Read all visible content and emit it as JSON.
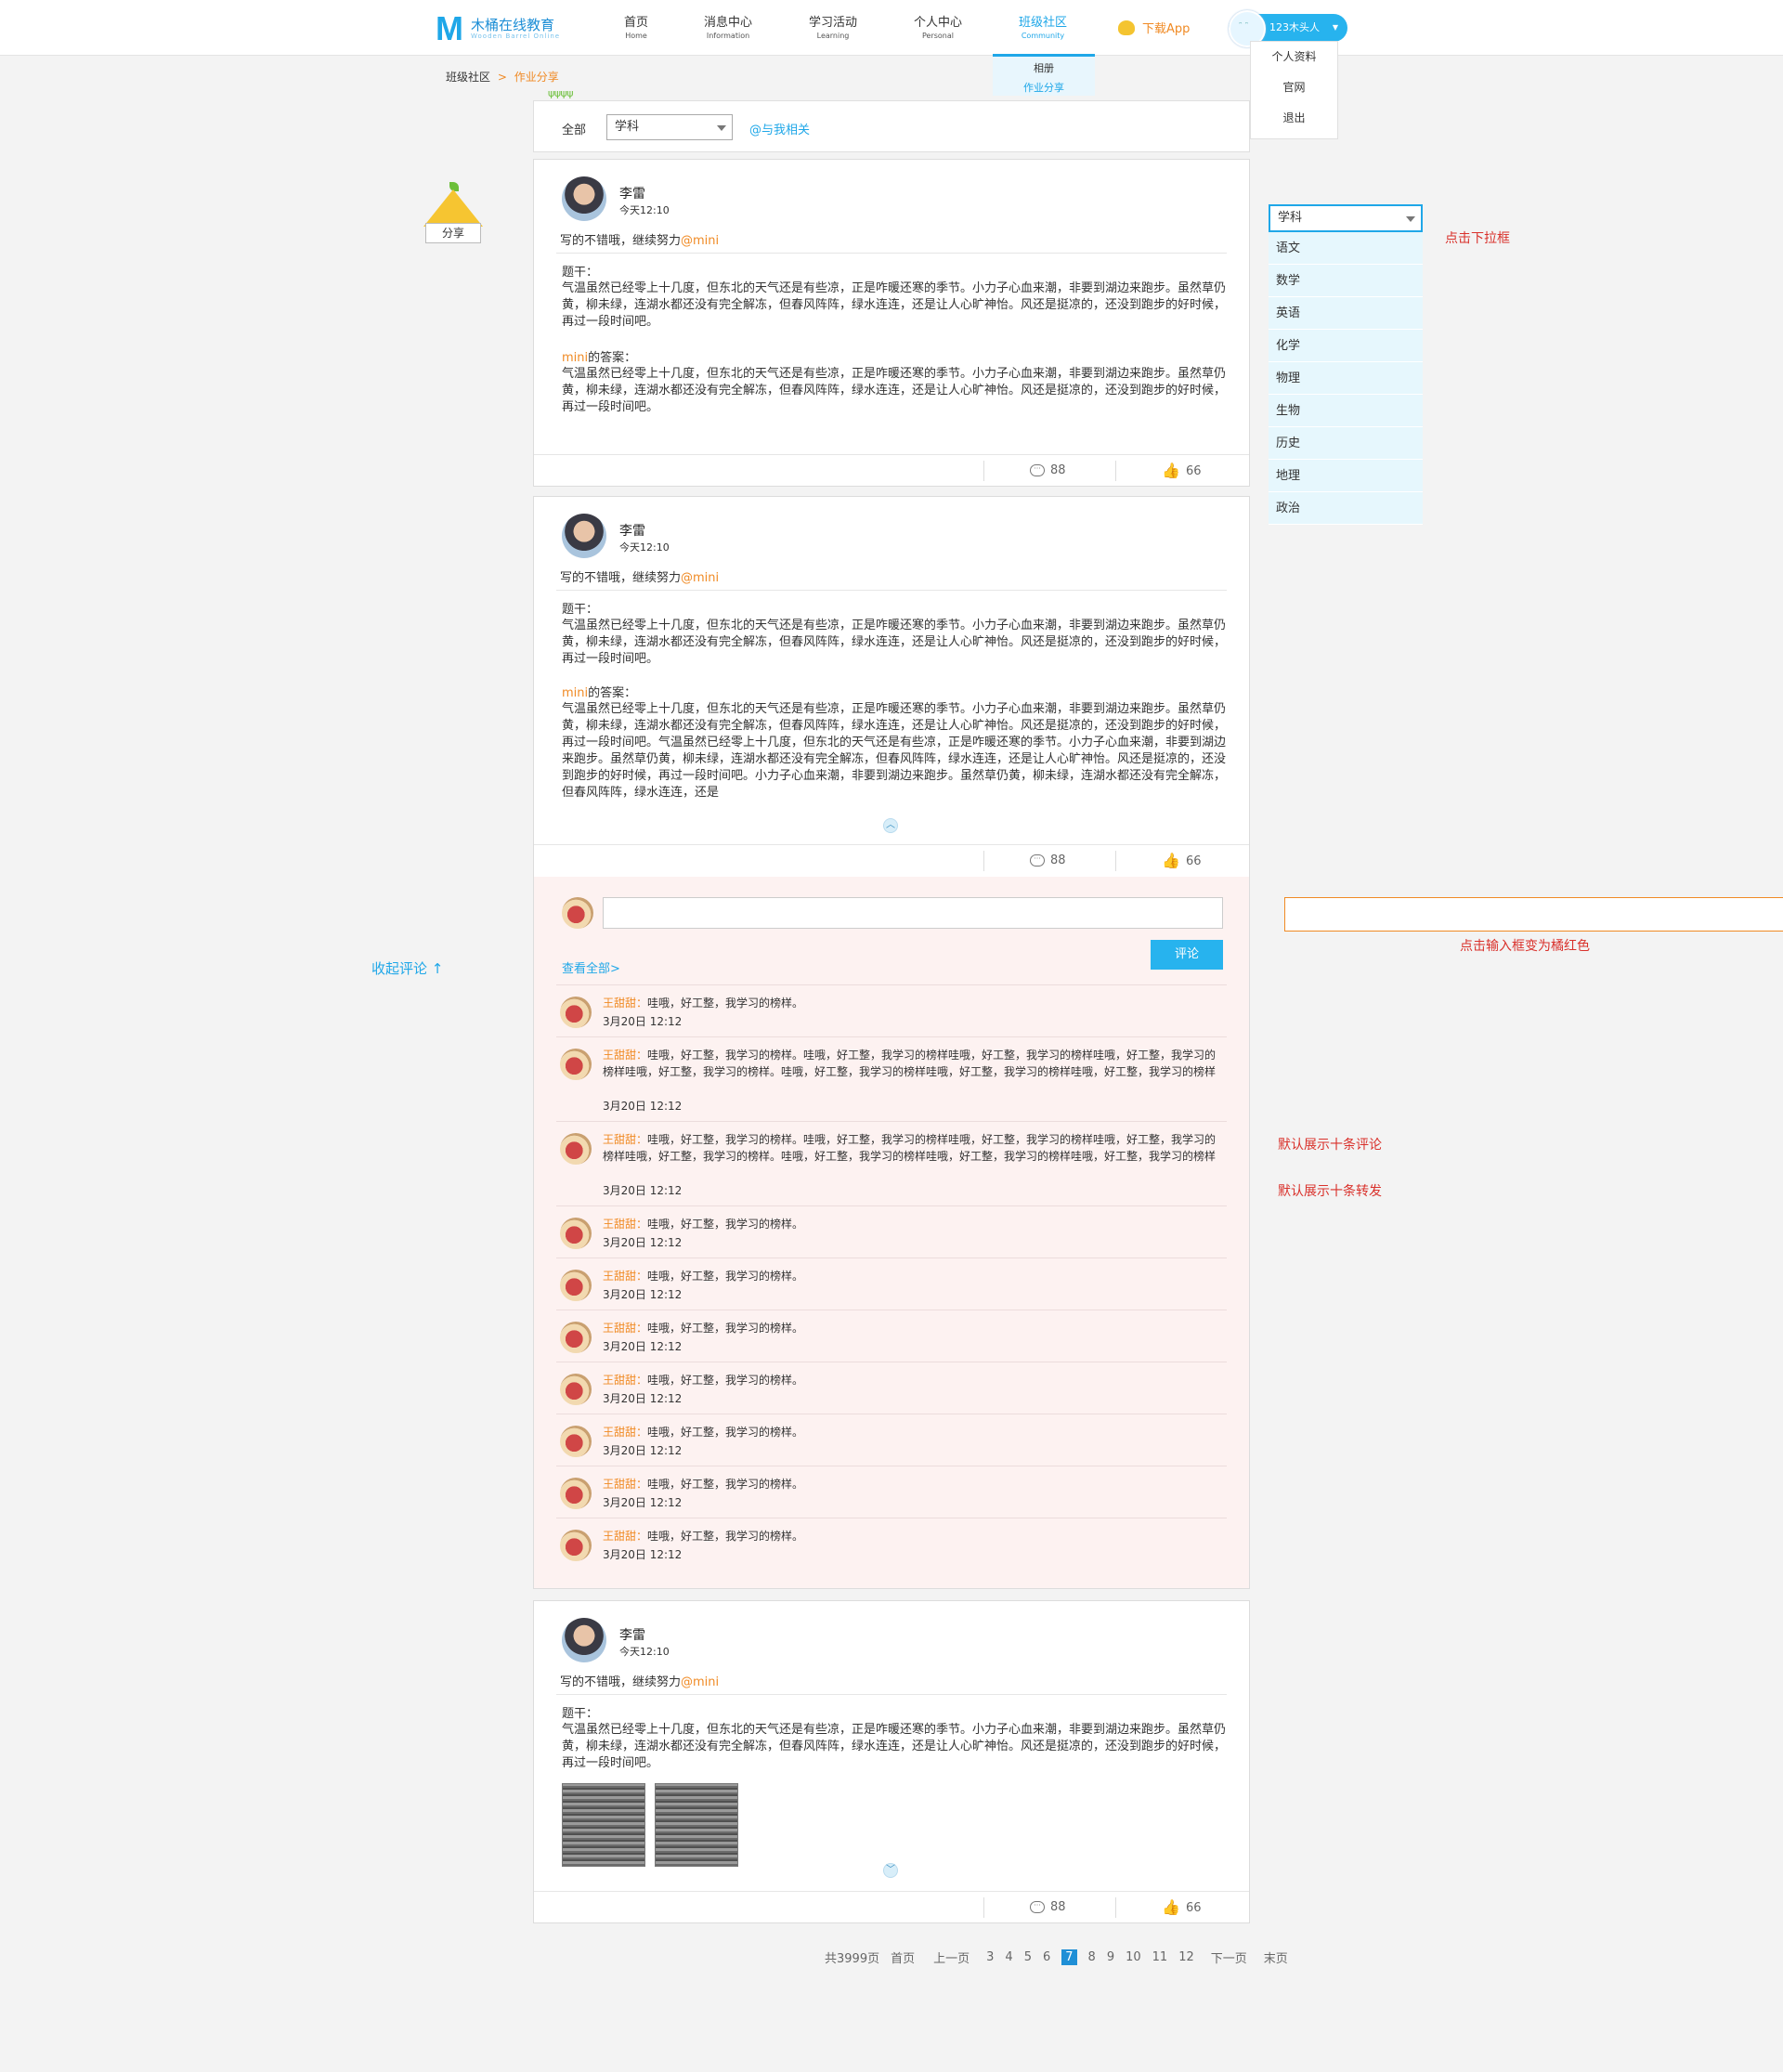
{
  "header": {
    "logo_mark": "M",
    "logo_text": "木桶在线教育",
    "logo_sub": "Wooden Barrel Online",
    "nav": [
      {
        "cn": "首页",
        "en": "Home"
      },
      {
        "cn": "消息中心",
        "en": "Information"
      },
      {
        "cn": "学习活动",
        "en": "Learning"
      },
      {
        "cn": "个人中心",
        "en": "Personal"
      },
      {
        "cn": "班级社区",
        "en": "Community"
      }
    ],
    "sub_menu": [
      "相册",
      "作业分享"
    ],
    "download": "下载App",
    "user_name": "123木头人",
    "user_menu": [
      "个人资料",
      "官网",
      "退出"
    ]
  },
  "breadcrumb": {
    "root": "班级社区",
    "sep": ">",
    "current": "作业分享"
  },
  "filter": {
    "all": "全部",
    "select": "学科",
    "related": "@与我相关"
  },
  "share_label": "分享",
  "posts": [
    {
      "author": "李雷",
      "time": "今天12:10",
      "comment": "写的不错哦，继续努力",
      "mention": "@mini",
      "q_label": "题干：",
      "question": "气温虽然已经零上十几度，但东北的天气还是有些凉，正是咋暖还寒的季节。小力子心血来潮，非要到湖边来跑步。虽然草仍黄，柳未绿，连湖水都还没有完全解冻，但春风阵阵，绿水连连，还是让人心旷神怡。风还是挺凉的，还没到跑步的好时候，再过一段时间吧。",
      "a_name": "mini",
      "a_label": "的答案：",
      "answer": "气温虽然已经零上十几度，但东北的天气还是有些凉，正是咋暖还寒的季节。小力子心血来潮，非要到湖边来跑步。虽然草仍黄，柳未绿，连湖水都还没有完全解冻，但春风阵阵，绿水连连，还是让人心旷神怡。风还是挺凉的，还没到跑步的好时候，再过一段时间吧。",
      "comments": "88",
      "likes": "66"
    },
    {
      "author": "李雷",
      "time": "今天12:10",
      "comment": "写的不错哦，继续努力",
      "mention": "@mini",
      "q_label": "题干：",
      "question": "气温虽然已经零上十几度，但东北的天气还是有些凉，正是咋暖还寒的季节。小力子心血来潮，非要到湖边来跑步。虽然草仍黄，柳未绿，连湖水都还没有完全解冻，但春风阵阵，绿水连连，还是让人心旷神怡。风还是挺凉的，还没到跑步的好时候，再过一段时间吧。",
      "a_name": "mini",
      "a_label": "的答案：",
      "answer": "气温虽然已经零上十几度，但东北的天气还是有些凉，正是咋暖还寒的季节。小力子心血来潮，非要到湖边来跑步。虽然草仍黄，柳未绿，连湖水都还没有完全解冻，但春风阵阵，绿水连连，还是让人心旷神怡。风还是挺凉的，还没到跑步的好时候，再过一段时间吧。气温虽然已经零上十几度，但东北的天气还是有些凉，正是咋暖还寒的季节。小力子心血来潮，非要到湖边来跑步。虽然草仍黄，柳未绿，连湖水都还没有完全解冻，但春风阵阵，绿水连连，还是让人心旷神怡。风还是挺凉的，还没到跑步的好时候，再过一段时间吧。小力子心血来潮，非要到湖边来跑步。虽然草仍黄，柳未绿，连湖水都还没有完全解冻，但春风阵阵，绿水连连，还是",
      "comments": "88",
      "likes": "66"
    },
    {
      "author": "李雷",
      "time": "今天12:10",
      "comment": "写的不错哦，继续努力",
      "mention": "@mini",
      "q_label": "题干：",
      "question": "气温虽然已经零上十几度，但东北的天气还是有些凉，正是咋暖还寒的季节。小力子心血来潮，非要到湖边来跑步。虽然草仍黄，柳未绿，连湖水都还没有完全解冻，但春风阵阵，绿水连连，还是让人心旷神怡。风还是挺凉的，还没到跑步的好时候，再过一段时间吧。",
      "comments": "88",
      "likes": "66"
    }
  ],
  "comment_box": {
    "submit": "评论",
    "view_all": "查看全部>",
    "items": [
      {
        "name": "王甜甜：",
        "text": "哇哦，好工整，我学习的榜样。",
        "date": "3月20日  12:12"
      },
      {
        "name": "王甜甜：",
        "text": "哇哦，好工整，我学习的榜样。哇哦，好工整，我学习的榜样哇哦，好工整，我学习的榜样哇哦，好工整，我学习的榜样哇哦，好工整，我学习的榜样。哇哦，好工整，我学习的榜样哇哦，好工整，我学习的榜样哇哦，好工整，我学习的榜样",
        "date": "3月20日  12:12"
      },
      {
        "name": "王甜甜：",
        "text": "哇哦，好工整，我学习的榜样。哇哦，好工整，我学习的榜样哇哦，好工整，我学习的榜样哇哦，好工整，我学习的榜样哇哦，好工整，我学习的榜样。哇哦，好工整，我学习的榜样哇哦，好工整，我学习的榜样哇哦，好工整，我学习的榜样",
        "date": "3月20日  12:12"
      },
      {
        "name": "王甜甜：",
        "text": "哇哦，好工整，我学习的榜样。",
        "date": "3月20日  12:12"
      },
      {
        "name": "王甜甜：",
        "text": "哇哦，好工整，我学习的榜样。",
        "date": "3月20日  12:12"
      },
      {
        "name": "王甜甜：",
        "text": "哇哦，好工整，我学习的榜样。",
        "date": "3月20日  12:12"
      },
      {
        "name": "王甜甜：",
        "text": "哇哦，好工整，我学习的榜样。",
        "date": "3月20日  12:12"
      },
      {
        "name": "王甜甜：",
        "text": "哇哦，好工整，我学习的榜样。",
        "date": "3月20日  12:12"
      },
      {
        "name": "王甜甜：",
        "text": "哇哦，好工整，我学习的榜样。",
        "date": "3月20日  12:12"
      },
      {
        "name": "王甜甜：",
        "text": "哇哦，好工整，我学习的榜样。",
        "date": "3月20日  12:12"
      }
    ]
  },
  "pagination": {
    "total": "共3999页",
    "first": "首页",
    "prev": "上一页",
    "pages": [
      "3",
      "4",
      "5",
      "6",
      "7",
      "8",
      "9",
      "10",
      "11",
      "12"
    ],
    "current": "7",
    "next": "下一页",
    "last": "末页"
  },
  "annotations": {
    "collapse": "收起评论 ↑",
    "dropdown_note": "点击下拉框",
    "input_note": "点击输入框变为橘红色",
    "default_comments": "默认展示十条评论",
    "default_reposts": "默认展示十条转发"
  },
  "subject_dropdown": {
    "selected": "学科",
    "options": [
      "语文",
      "数学",
      "英语",
      "化学",
      "物理",
      "生物",
      "历史",
      "地理",
      "政治"
    ]
  },
  "colors": {
    "accent": "#1fa7e8",
    "orange": "#f08a24",
    "note_red": "#d9312b",
    "comment_bg": "#fdf2f1"
  }
}
